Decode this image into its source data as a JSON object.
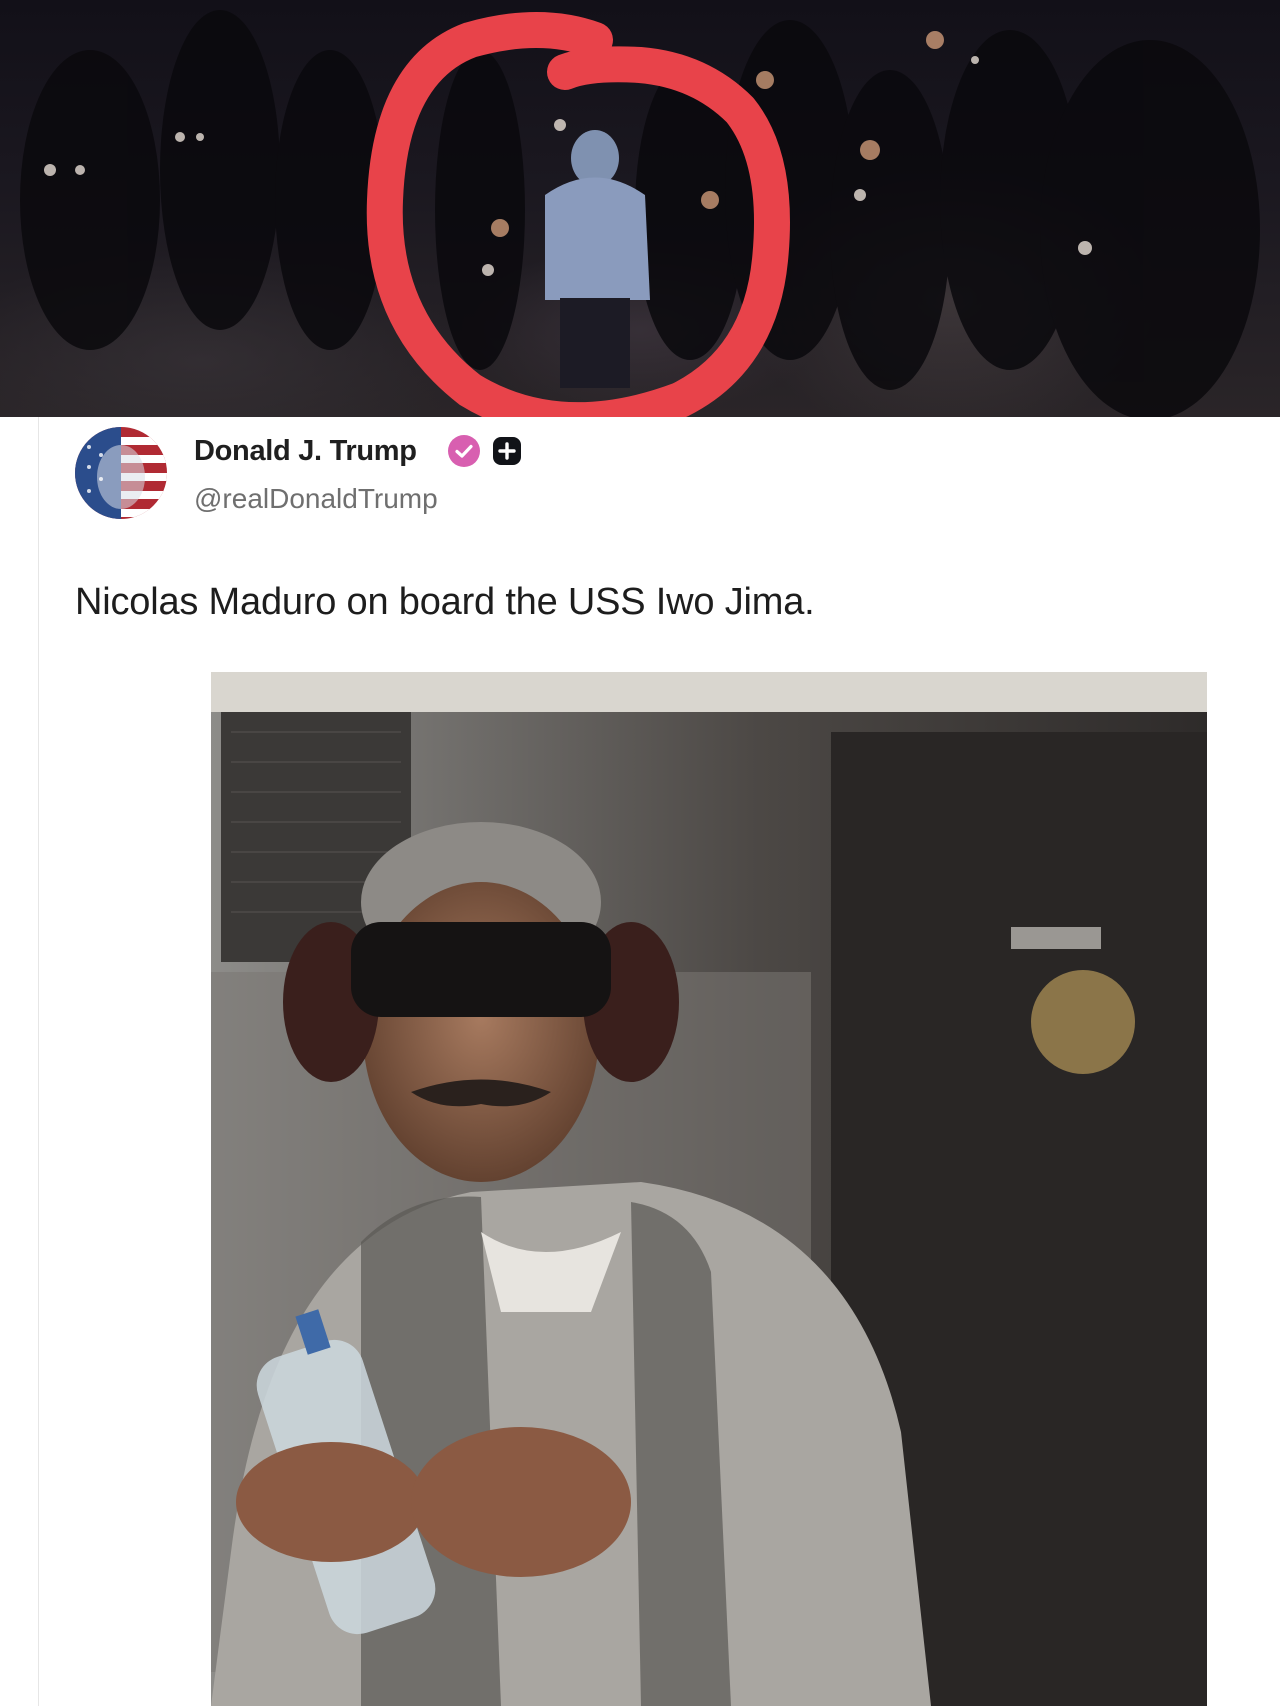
{
  "post": {
    "author_name": "Donald J. Trump",
    "handle": "@realDonaldTrump",
    "text": "Nicolas Maduro on board the USS Iwo Jima."
  },
  "icons": {
    "verified": "verified-badge-icon",
    "plus": "plus-badge-icon",
    "highlight": "red-circle-annotation"
  },
  "colors": {
    "verified_badge": "#d85fb0",
    "highlight_circle": "#e8434a",
    "text": "#1d1d1d",
    "handle": "#6f6f6f"
  }
}
